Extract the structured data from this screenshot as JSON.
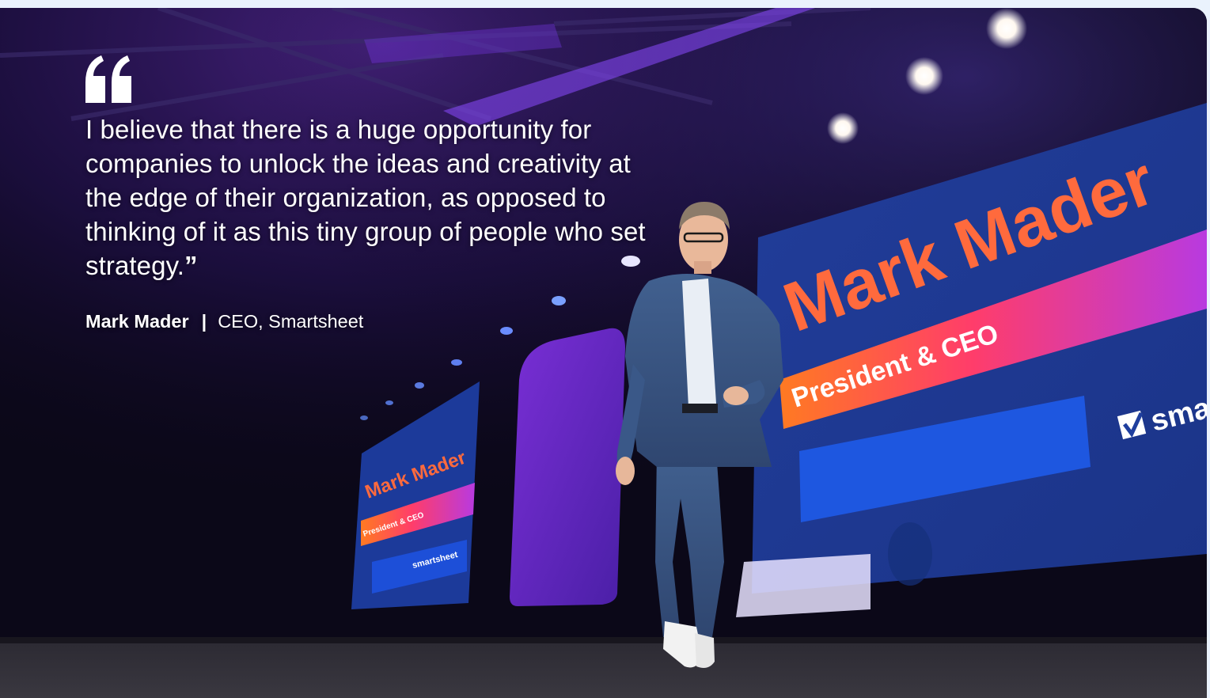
{
  "quote": {
    "mark_icon": "open-quote-icon",
    "text": "I believe that there is a huge opportunity for companies to unlock the ideas and creativity at the edge of their organization, as opposed to thinking of it as this tiny group of people who set strategy.",
    "close_mark": "”"
  },
  "attribution": {
    "name": "Mark Mader",
    "separator": "|",
    "role": "CEO, Smartsheet"
  },
  "photo": {
    "screen_main": {
      "name": "Mark Mader",
      "title": "President & CEO",
      "logo": "sma"
    },
    "screen_small": {
      "name": "Mark Mader",
      "title": "President & CEO",
      "logo": "smartsheet"
    }
  },
  "colors": {
    "page_bg": "#eaf2fd",
    "screen_blue": "#1f3f9e",
    "name_orange": "#ff6a3d",
    "banner_orange": "#ff6e2a",
    "banner_purple": "#c23ad6"
  }
}
